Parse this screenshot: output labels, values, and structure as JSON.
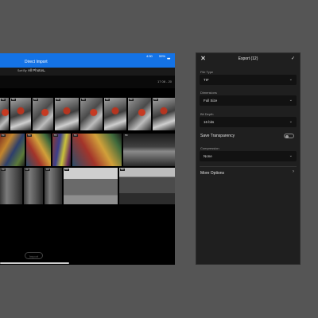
{
  "tablet": {
    "status_time": "4:50",
    "status_battery": "59%",
    "title": "Direct Import",
    "more_icon": "more-horizontal-icon",
    "filter_label": "Sort By",
    "filter_value": "All Photos",
    "date_label": "17 08 - 20",
    "import_button": "Import",
    "badges": [
      "TIF",
      "TIF",
      "TIF",
      "TIF",
      "TIF",
      "TIF",
      "TIF",
      "TIF",
      "TIF",
      "TIF",
      "TIF",
      "TIF",
      "TIF",
      "TIF",
      "TIF",
      "TIF",
      "TIF",
      "TIF",
      "TIF"
    ]
  },
  "export": {
    "title": "Export (12)",
    "close_icon": "close-icon",
    "confirm_icon": "check-icon",
    "file_type": {
      "label": "File Type",
      "value": "TIF"
    },
    "dimensions": {
      "label": "Dimensions",
      "value": "Full Size"
    },
    "bit_depth": {
      "label": "Bit Depth",
      "value": "16 bits"
    },
    "save_transparency": {
      "label": "Save Transparency",
      "enabled": false
    },
    "compression": {
      "label": "Compression",
      "value": "None"
    },
    "more_options": "More Options"
  }
}
